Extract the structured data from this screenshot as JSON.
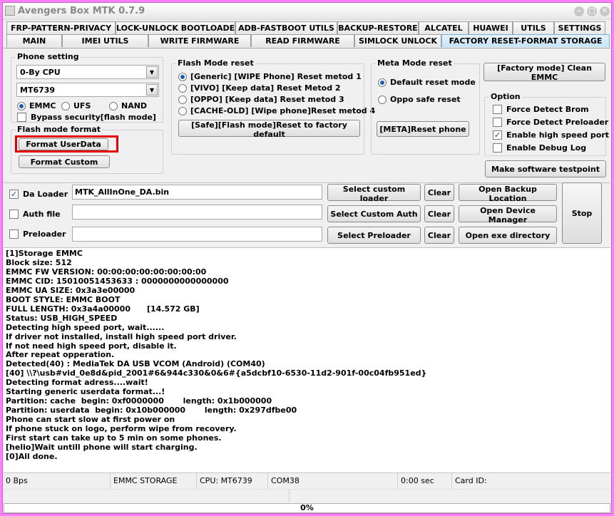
{
  "window": {
    "title": "Avengers Box MTK 0.7.9"
  },
  "tabs_top": [
    "FRP-PATTERN-PRIVACY",
    "LOCK-UNLOCK BOOTLOADER",
    "ADB-FASTBOOT UTILS",
    "BACKUP-RESTORE",
    "ALCATEL",
    "HUAWEI",
    "UTILS",
    "SETTINGS"
  ],
  "tabs_bottom": [
    "MAIN",
    "IMEI UTILS",
    "WRITE FIRMWARE",
    "READ FIRMWARE",
    "SIMLOCK UNLOCK",
    "FACTORY RESET-FORMAT STORAGE"
  ],
  "active_tab": "FACTORY RESET-FORMAT STORAGE",
  "phone_setting": {
    "legend": "Phone setting",
    "cpu_select": "0-By CPU",
    "model_select": "MT6739",
    "storage_options": [
      "EMMC",
      "UFS",
      "NAND"
    ],
    "storage_selected": "EMMC",
    "bypass_label": "Bypass security[flash mode]",
    "bypass_checked": false
  },
  "flash_mode_format": {
    "legend": "Flash mode format",
    "format_userdata": "Format UserData",
    "format_custom": "Format Custom"
  },
  "flash_mode_reset": {
    "legend": "Flash Mode reset",
    "options": [
      "[Generic] [WIPE Phone] Reset metod 1",
      "[VIVO] [Keep data] Reset Metod 2",
      "[OPPO] [Keep data] Reset metod 3",
      "[CACHE-OLD] [Wipe phone]Reset metod 4"
    ],
    "selected_index": 0,
    "button": "[Safe][Flash mode]Reset to factory default"
  },
  "meta_mode_reset": {
    "legend": "Meta Mode reset",
    "options": [
      "Default reset mode",
      "Oppo safe reset"
    ],
    "selected_index": 0,
    "button": "[META]Reset phone"
  },
  "factory_mode_button": "[Factory mode] Clean EMMC",
  "option_group": {
    "legend": "Option",
    "items": [
      {
        "label": "Force Detect Brom",
        "checked": false
      },
      {
        "label": "Force Detect Preloader",
        "checked": false
      },
      {
        "label": "Enable high speed port",
        "checked": true
      },
      {
        "label": "Enable Debug Log",
        "checked": false
      }
    ]
  },
  "testpoint_button": "Make software testpoint",
  "loaders": [
    {
      "label": "Da Loader",
      "checked": true,
      "value": "MTK_AllInOne_DA.bin",
      "select_button": "Select custom loader",
      "clear_button": "Clear",
      "open_button": "Open Backup Location"
    },
    {
      "label": "Auth file",
      "checked": false,
      "value": "",
      "select_button": "Select Custom Auth",
      "clear_button": "Clear",
      "open_button": "Open Device Manager"
    },
    {
      "label": "Preloader",
      "checked": false,
      "value": "",
      "select_button": "Select Preloader",
      "clear_button": "Clear",
      "open_button": "Open exe directory"
    }
  ],
  "stop_button": "Stop",
  "log_lines": [
    "[1]Storage EMMC",
    "Block size: 512",
    "EMMC FW VERSION: 00:00:00:00:00:00:00:00",
    "EMMC CID: 15010051453633 : 0000000000000000",
    "EMMC UA SIZE: 0x3a3e00000",
    "BOOT STYLE: EMMC BOOT",
    "FULL LENGTH: 0x3a4a00000      [14.572 GB]",
    "Status: USB_HIGH_SPEED",
    "Detecting high speed port, wait......",
    "If driver not installed, install high speed port driver.",
    "If not need high speed port, disable it.",
    "After repeat opperation.",
    "Detected(40) : MediaTek DA USB VCOM (Android) (COM40)",
    "[40] \\\\?\\usb#vid_0e8d&pid_2001#6&944c330&0&6#{a5dcbf10-6530-11d2-901f-00c04fb951ed}",
    "Detecting format adress....wait!",
    "Starting generic userdata format...!",
    "Partition: cache  begin: 0xf0000000       length: 0x1b000000",
    "Partition: userdata  begin: 0x10b000000       length: 0x297dfbe00",
    "Phone can start slow at first power on",
    "If phone stuck on logo, perform wipe from recovery.",
    "First start can take up to 5 min on some phones.",
    "[helio]Wait untill phone will start charging.",
    "[0]All done."
  ],
  "status_bar": {
    "speed": "0 Bps",
    "storage": "EMMC STORAGE",
    "cpu": "CPU: MT6739",
    "port": "COM38",
    "time": "0:00 sec",
    "card_id": "Card ID:"
  },
  "progress": {
    "label": "0%",
    "value": 0
  },
  "colors": {
    "highlight_box": "#e00000",
    "window_border": "#ff80ff"
  }
}
